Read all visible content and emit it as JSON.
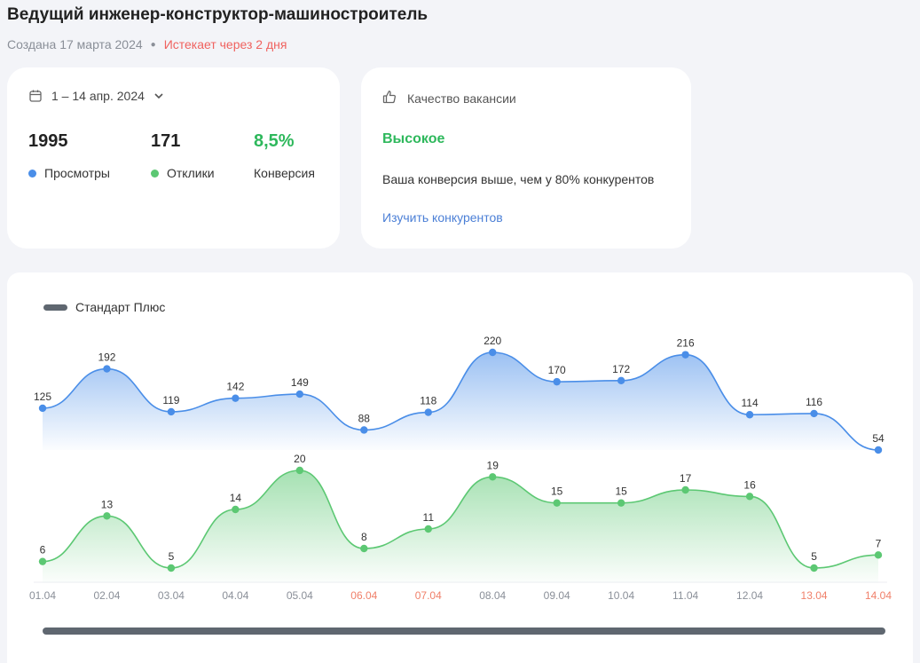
{
  "vacancy": {
    "title": "Ведущий инженер-конструктор-машиностроитель",
    "created": "Создана 17 марта 2024",
    "expires": "Истекает через 2 дня"
  },
  "stats": {
    "date_range": "1 – 14 апр. 2024",
    "views": {
      "value": "1995",
      "label": "Просмотры"
    },
    "responses": {
      "value": "171",
      "label": "Отклики"
    },
    "conversion": {
      "value": "8,5%",
      "label": "Конверсия"
    }
  },
  "quality": {
    "header": "Качество вакансии",
    "level": "Высокое",
    "description": "Ваша конверсия выше, чем у 80% конкурентов",
    "link": "Изучить конкурентов"
  },
  "colors": {
    "views": "#4a8ee8",
    "responses": "#5cc873",
    "weekend": "#f0806a",
    "accent_green": "#2eb85c",
    "link": "#4b7fd6"
  },
  "chart_data": {
    "type": "area",
    "legend": "Стандарт Плюс",
    "x": [
      "01.04",
      "02.04",
      "03.04",
      "04.04",
      "05.04",
      "06.04",
      "07.04",
      "08.04",
      "09.04",
      "10.04",
      "11.04",
      "12.04",
      "13.04",
      "14.04"
    ],
    "weekend_indices": [
      5,
      6,
      12,
      13
    ],
    "series": [
      {
        "name": "Просмотры",
        "values": [
          125,
          192,
          119,
          142,
          149,
          88,
          118,
          220,
          170,
          172,
          216,
          114,
          116,
          54
        ]
      },
      {
        "name": "Отклики",
        "values": [
          6,
          13,
          5,
          14,
          20,
          8,
          11,
          19,
          15,
          15,
          17,
          16,
          5,
          7
        ]
      }
    ]
  }
}
